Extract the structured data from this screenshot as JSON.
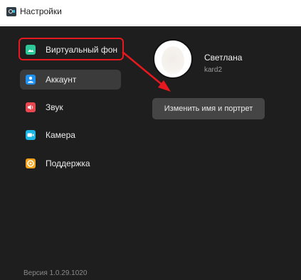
{
  "window": {
    "title": "Настройки"
  },
  "sidebar": {
    "items": [
      {
        "label": "Виртуальный фон",
        "icon": "image-icon",
        "icon_color": "#2ec79a",
        "highlighted": true
      },
      {
        "label": "Аккаунт",
        "icon": "user-icon",
        "icon_color": "#1f8ff0",
        "active": true
      },
      {
        "label": "Звук",
        "icon": "speaker-icon",
        "icon_color": "#e8474f"
      },
      {
        "label": "Камера",
        "icon": "camera-icon",
        "icon_color": "#19b6e6"
      },
      {
        "label": "Поддержка",
        "icon": "lifebuoy-icon",
        "icon_color": "#f5a31a"
      }
    ],
    "version": "Версия 1.0.29.1020"
  },
  "profile": {
    "name": "Светлана",
    "login": "kard2",
    "edit_button": "Изменить имя и портрет"
  },
  "annotation": {
    "color": "#e8181f"
  }
}
